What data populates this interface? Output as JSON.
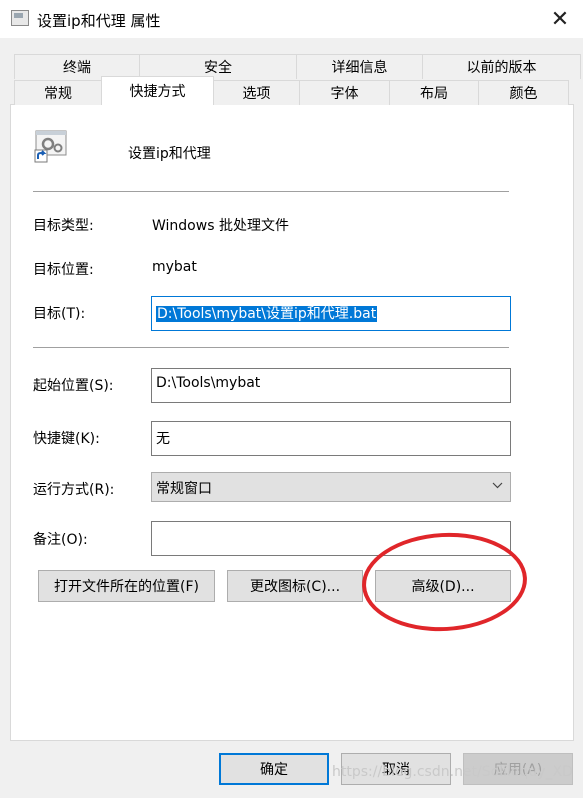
{
  "window": {
    "title": "设置ip和代理 属性",
    "close_glyph": "✕"
  },
  "tabs": {
    "row1": [
      "终端",
      "安全",
      "详细信息",
      "以前的版本"
    ],
    "row2": [
      "常规",
      "快捷方式",
      "选项",
      "字体",
      "布局",
      "颜色"
    ],
    "active": "快捷方式"
  },
  "shortcut": {
    "name": "设置ip和代理",
    "icon": "batch-file-shortcut-icon",
    "target_type_label": "目标类型:",
    "target_type_value": "Windows 批处理文件",
    "target_location_label": "目标位置:",
    "target_location_value": "mybat",
    "target_label": "目标(T):",
    "target_value": "D:\\Tools\\mybat\\设置ip和代理.bat",
    "start_in_label": "起始位置(S):",
    "start_in_value": "D:\\Tools\\mybat",
    "hotkey_label": "快捷键(K):",
    "hotkey_value": "无",
    "run_label": "运行方式(R):",
    "run_value": "常规窗口",
    "comment_label": "备注(O):",
    "comment_value": ""
  },
  "buttons": {
    "open_location": "打开文件所在的位置(F)",
    "change_icon": "更改图标(C)...",
    "advanced": "高级(D)...",
    "ok": "确定",
    "cancel": "取消",
    "apply": "应用(A)"
  },
  "watermark": "https://blog.csdn.net/Soliloquy_XD",
  "colors": {
    "accent": "#0078d7",
    "annotation": "#e0262a"
  }
}
